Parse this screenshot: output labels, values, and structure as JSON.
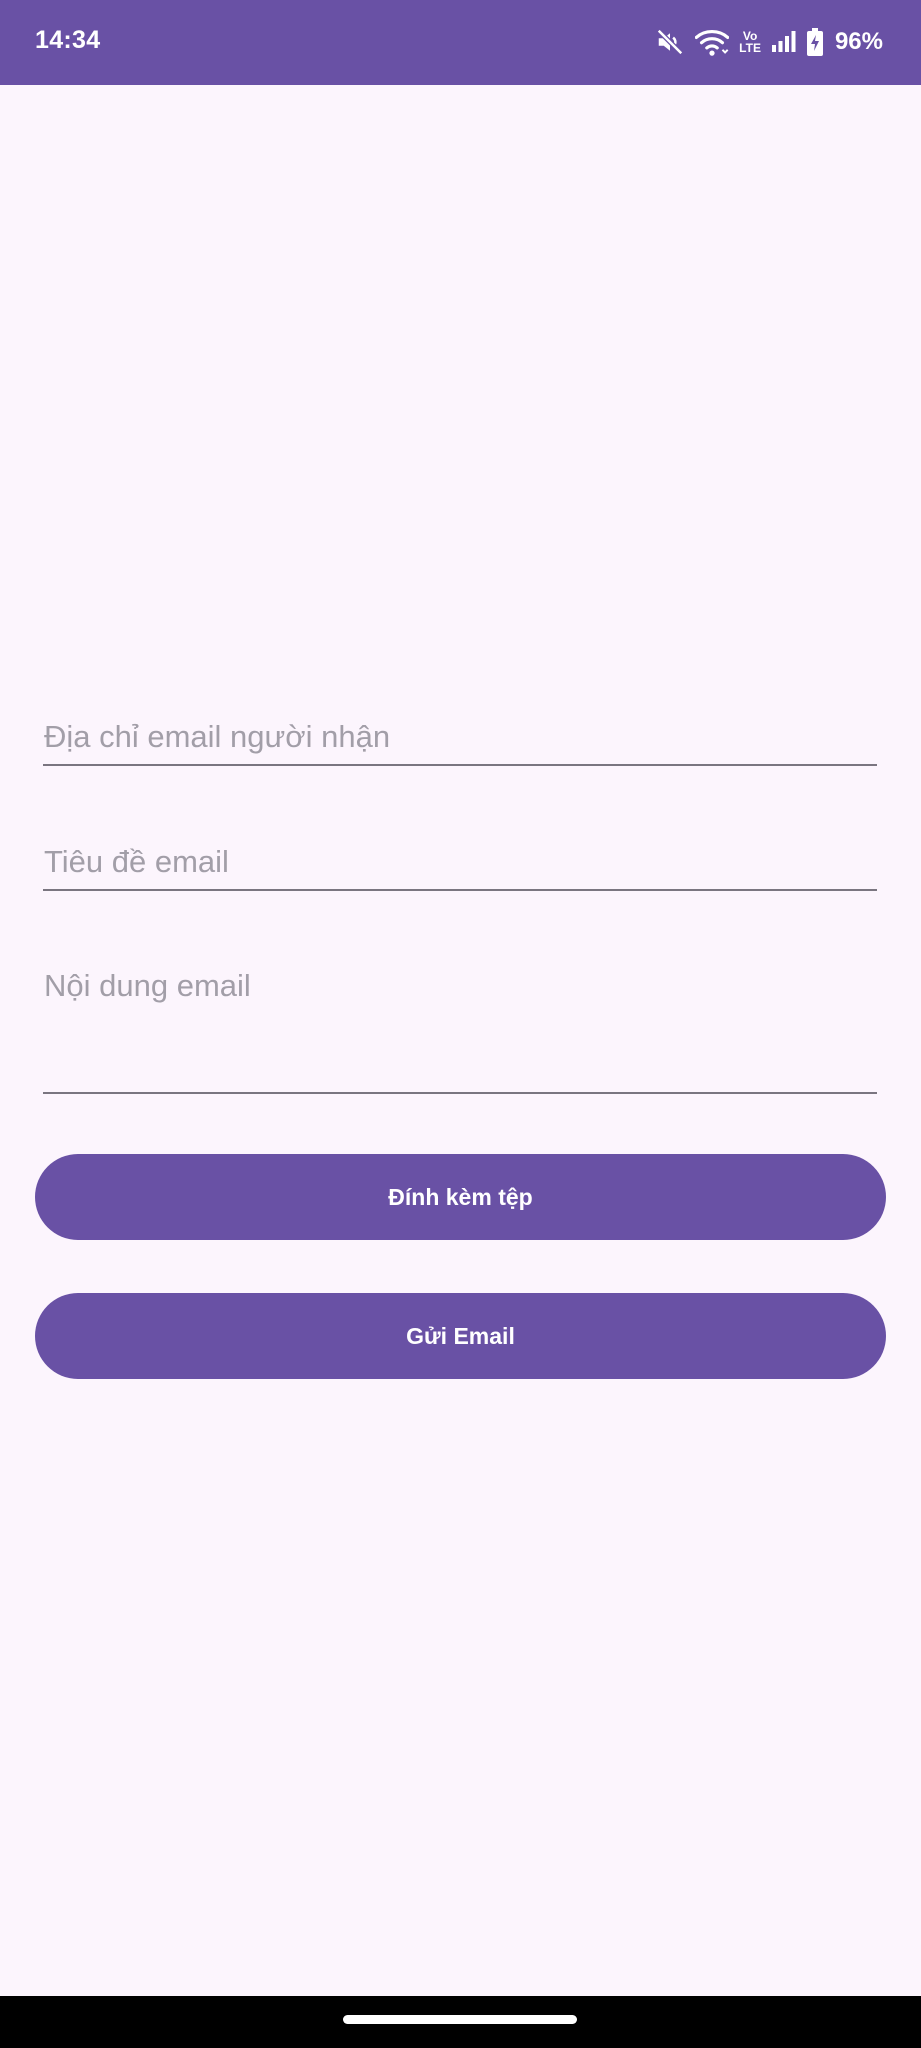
{
  "status_bar": {
    "time": "14:34",
    "icons": [
      "mute-icon",
      "wifi-icon",
      "volte-icon",
      "signal-icon",
      "battery-charging-icon"
    ],
    "volte_top": "Vo",
    "volte_bottom": "LTE",
    "battery": "96%"
  },
  "form": {
    "recipient_placeholder": "Địa chỉ email người nhận",
    "recipient_value": "",
    "subject_placeholder": "Tiêu đề email",
    "subject_value": "",
    "body_placeholder": "Nội dung email",
    "body_value": ""
  },
  "buttons": {
    "attach_label": "Đính kèm tệp",
    "send_label": "Gửi Email"
  },
  "colors": {
    "primary": "#6951a5",
    "background": "#fcf5fd",
    "placeholder": "#a29ea8",
    "underline": "#7a7580"
  }
}
